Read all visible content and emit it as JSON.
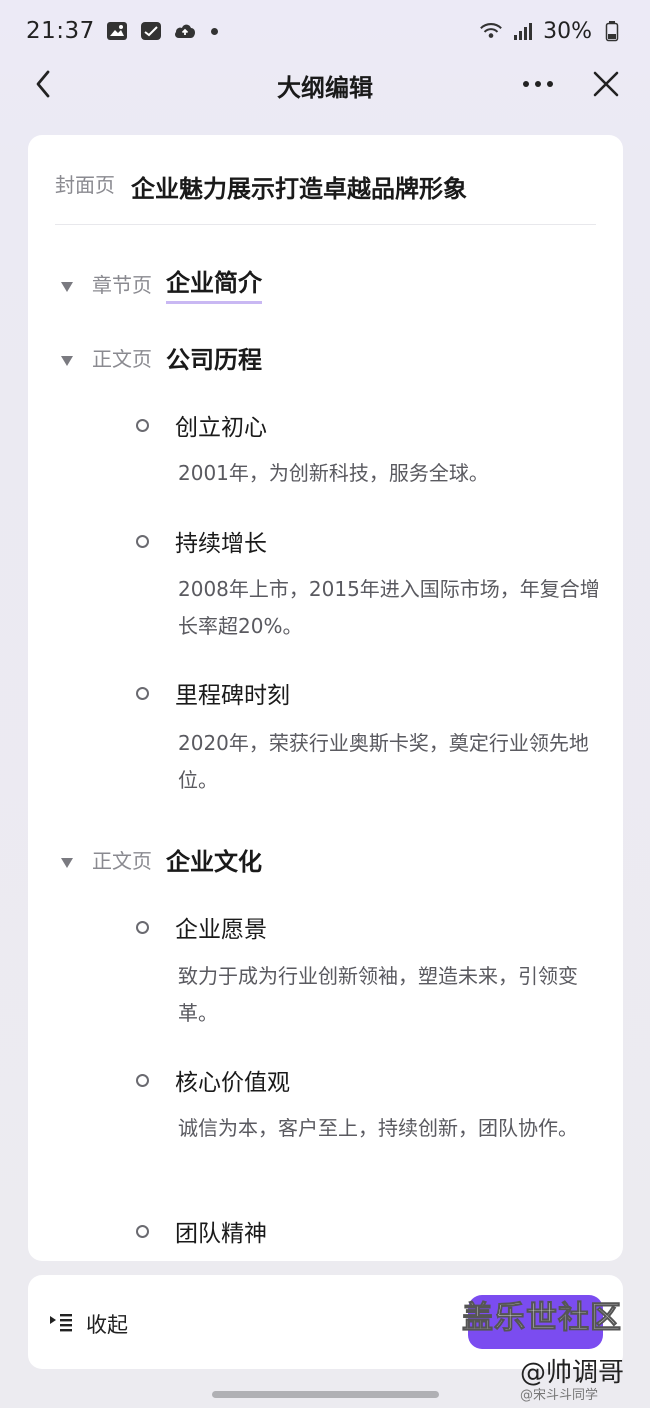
{
  "status_bar": {
    "time": "21:37",
    "battery": "30%",
    "icons": [
      "image-icon",
      "task-icon",
      "cloud-icon",
      "wifi-icon",
      "signal-icon",
      "battery-icon"
    ]
  },
  "nav": {
    "title": "大纲编辑",
    "icons": [
      "back-icon",
      "more-icon",
      "close-icon"
    ]
  },
  "cover": {
    "type_label": "封面页",
    "title": "企业魅力展示打造卓越品牌形象"
  },
  "sections": [
    {
      "type_label": "章节页",
      "title": "企业简介",
      "items": []
    },
    {
      "type_label": "正文页",
      "title": "公司历程",
      "items": [
        {
          "title": "创立初心",
          "desc": "2001年，为创新科技，服务全球。"
        },
        {
          "title": "持续增长",
          "desc": "2008年上市，2015年进入国际市场，年复合增长率超20%。"
        },
        {
          "title": "里程碑时刻",
          "desc": "2020年，荣获行业奥斯卡奖，奠定行业领先地位。"
        }
      ]
    },
    {
      "type_label": "正文页",
      "title": "企业文化",
      "items": [
        {
          "title": "企业愿景",
          "desc": "致力于成为行业创新领袖，塑造未来，引领变革。"
        },
        {
          "title": "核心价值观",
          "desc": "诚信为本，客户至上，持续创新，团队协作。"
        },
        {
          "title": "团队精神",
          "desc": ""
        }
      ]
    }
  ],
  "bottom_bar": {
    "collapse_label": "收起"
  },
  "watermark": {
    "main": "盖乐世社区",
    "handle": "@帅调哥",
    "sub": "@宋斗斗同学"
  },
  "colors": {
    "accent": "#7b4cf0",
    "underline": "#c9b8f3",
    "background": "#ecebf0"
  }
}
